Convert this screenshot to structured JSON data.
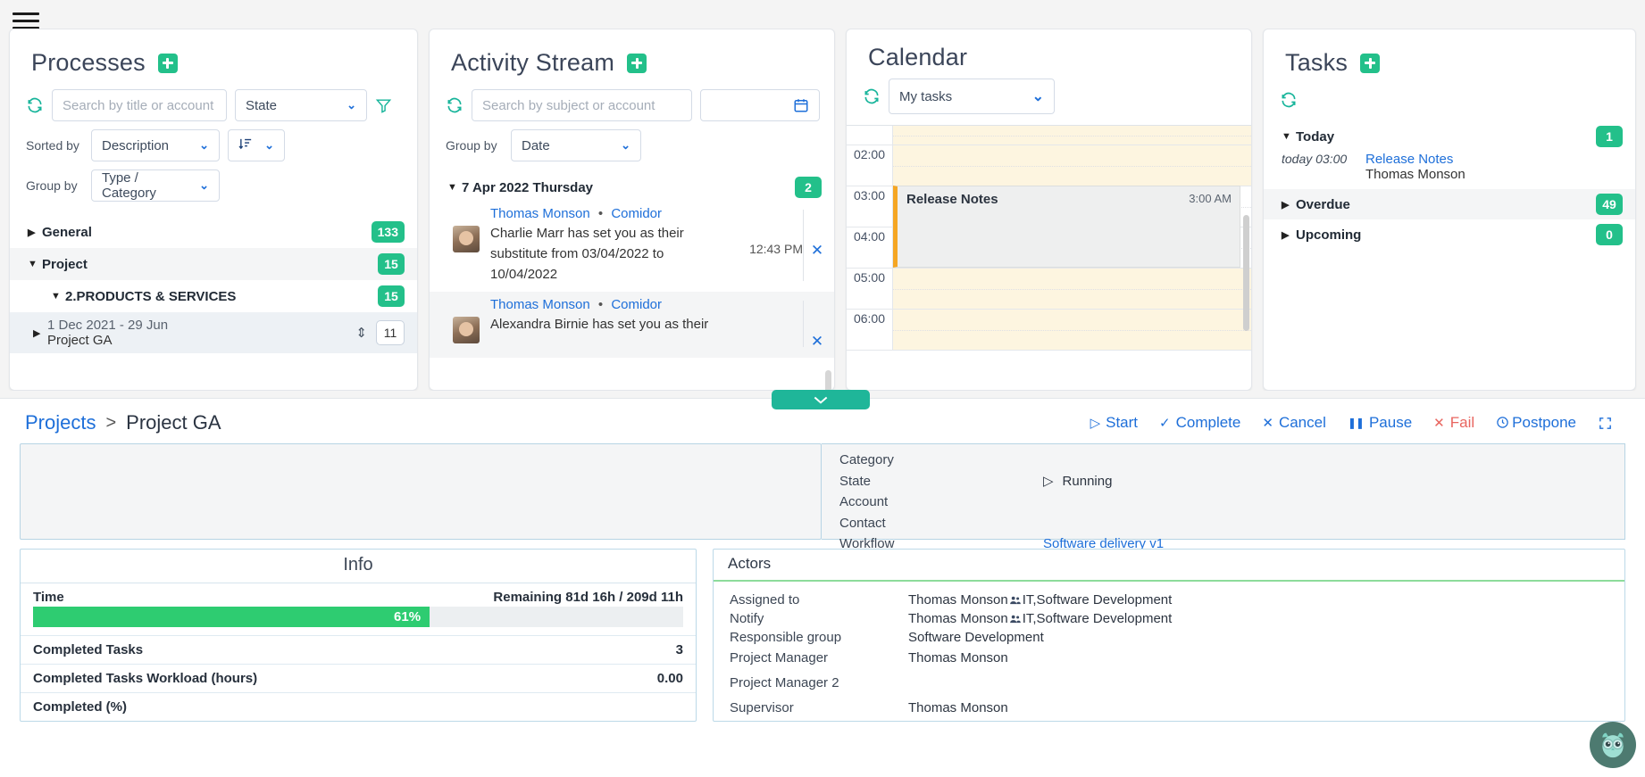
{
  "topbar": {
    "menu_icon": "hamburger-icon"
  },
  "processes": {
    "title": "Processes",
    "add_label": "+",
    "search_placeholder": "Search by title or account",
    "state_select": "State",
    "sorted_by_label": "Sorted by",
    "sorted_by_value": "Description",
    "group_by_label": "Group by",
    "group_by_value": "Type / Category",
    "groups": [
      {
        "name": "General",
        "count": "133",
        "expanded": false
      },
      {
        "name": "Project",
        "count": "15",
        "expanded": true
      },
      {
        "name": "2.PRODUCTS & SERVICES",
        "count": "15",
        "expanded": true
      }
    ],
    "item": {
      "date_range": "1 Dec 2021  -  29 Jun",
      "title": "Project GA",
      "count": "11"
    }
  },
  "activity": {
    "title": "Activity Stream",
    "search_placeholder": "Search by subject or account",
    "date_value": "",
    "group_by_label": "Group by",
    "group_by_value": "Date",
    "group_header": "7 Apr 2022 Thursday",
    "group_count": "2",
    "items": [
      {
        "user": "Thomas Monson",
        "app": "Comidor",
        "text": "Charlie Marr has set you as their substitute from 03/04/2022 to 10/04/2022",
        "time": "12:43 PM"
      },
      {
        "user": "Thomas Monson",
        "app": "Comidor",
        "text": "Alexandra Birnie has set you as their",
        "time": ""
      }
    ]
  },
  "calendar": {
    "title": "Calendar",
    "filter_value": "My tasks",
    "hours": [
      "02:00",
      "03:00",
      "04:00",
      "05:00",
      "06:00"
    ],
    "event": {
      "title": "Release Notes",
      "time": "3:00 AM"
    }
  },
  "tasks": {
    "title": "Tasks",
    "groups": [
      {
        "name": "Today",
        "count": "1",
        "expanded": true
      },
      {
        "name": "Overdue",
        "count": "49",
        "expanded": false
      },
      {
        "name": "Upcoming",
        "count": "0",
        "expanded": false
      }
    ],
    "today_item": {
      "time": "today 03:00",
      "link": "Release Notes",
      "owner": "Thomas Monson"
    }
  },
  "detail": {
    "breadcrumb_root": "Projects",
    "breadcrumb_sep": ">",
    "breadcrumb_current": "Project GA",
    "actions": [
      {
        "label": "Start",
        "glyph": "▷"
      },
      {
        "label": "Complete",
        "glyph": "✓"
      },
      {
        "label": "Cancel",
        "glyph": "✕"
      },
      {
        "label": "Pause",
        "glyph": "❚❚"
      },
      {
        "label": "Fail",
        "glyph": "✕"
      },
      {
        "label": "Postpone",
        "glyph": "◕"
      }
    ],
    "fields": [
      {
        "label": "Category",
        "value": ""
      },
      {
        "label": "State",
        "value": "Running"
      },
      {
        "label": "Account",
        "value": ""
      },
      {
        "label": "Contact",
        "value": ""
      },
      {
        "label": "Workflow",
        "value": "Software delivery v1"
      }
    ]
  },
  "info": {
    "title": "Info",
    "time_label": "Time",
    "time_remaining": "Remaining 81d 16h / 209d 11h",
    "progress_pct": "61%",
    "progress_value": 61,
    "rows": [
      {
        "label": "Completed Tasks",
        "value": "3"
      },
      {
        "label": "Completed Tasks Workload (hours)",
        "value": "0.00"
      },
      {
        "label": "Completed (%)",
        "value": ""
      }
    ]
  },
  "actors": {
    "title": "Actors",
    "rows": [
      {
        "label": "Assigned to",
        "value": "Thomas Monson",
        "value2": "IT,Software Development",
        "group_icon": true
      },
      {
        "label": "Notify",
        "value": "Thomas Monson",
        "value2": "IT,Software Development",
        "group_icon": true
      },
      {
        "label": "Responsible group",
        "value": "Software Development",
        "value2": "",
        "group_icon": false
      },
      {
        "label": "Project Manager",
        "value": "Thomas Monson",
        "value2": "",
        "group_icon": false
      },
      {
        "label": "Project Manager 2",
        "value": "",
        "value2": "",
        "group_icon": false
      },
      {
        "label": "Supervisor",
        "value": "Thomas Monson",
        "value2": "",
        "group_icon": false
      }
    ]
  },
  "colors": {
    "accent_green": "#23c08a",
    "link_blue": "#1e6fd9",
    "progress_green": "#2ecc71",
    "event_orange": "#f5a623",
    "fail_red": "#e8655f"
  },
  "assistant": {
    "name": "owl-assistant"
  }
}
